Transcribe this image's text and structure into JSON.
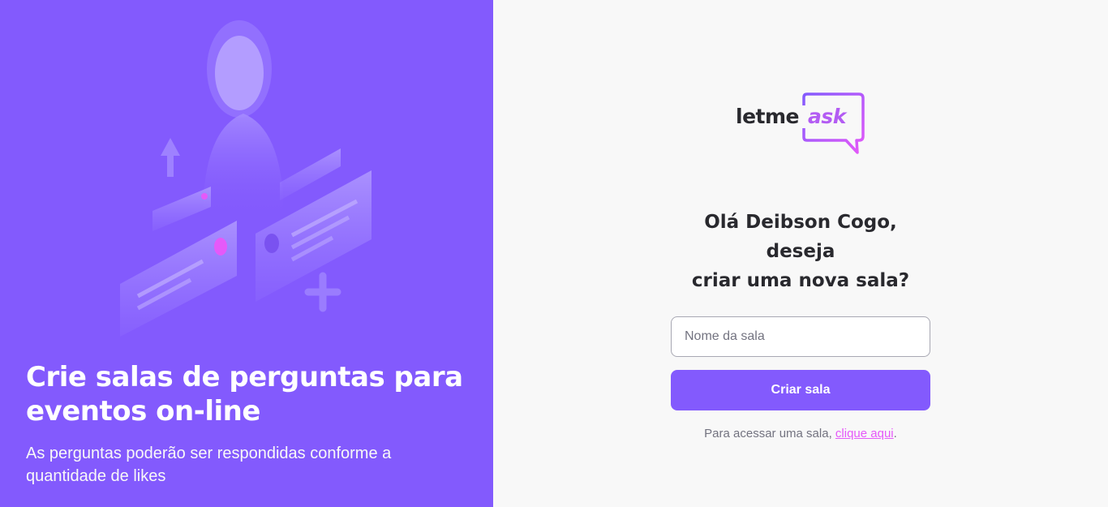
{
  "aside": {
    "title": "Crie salas de perguntas para eventos on-line",
    "subtitle": "As perguntas poderão ser respondidas conforme a quantidade de likes",
    "illustration_icon": "people-questions-illustration"
  },
  "logo": {
    "text_main": "letme",
    "text_accent": "ask",
    "icon": "speech-bubble-icon"
  },
  "main": {
    "greeting_line1": "Olá Deibson Cogo, deseja",
    "greeting_line2": "criar uma nova sala?",
    "room_input": {
      "placeholder": "Nome da sala",
      "value": ""
    },
    "create_button_label": "Criar sala",
    "help_text": "Para acessar uma sala,",
    "help_link": "clique aqui",
    "help_suffix": "."
  },
  "colors": {
    "primary": "#835afd",
    "accent": "#e559f9",
    "background": "#f8f8f8",
    "text_dark": "#29292e",
    "text_muted": "#737380"
  }
}
